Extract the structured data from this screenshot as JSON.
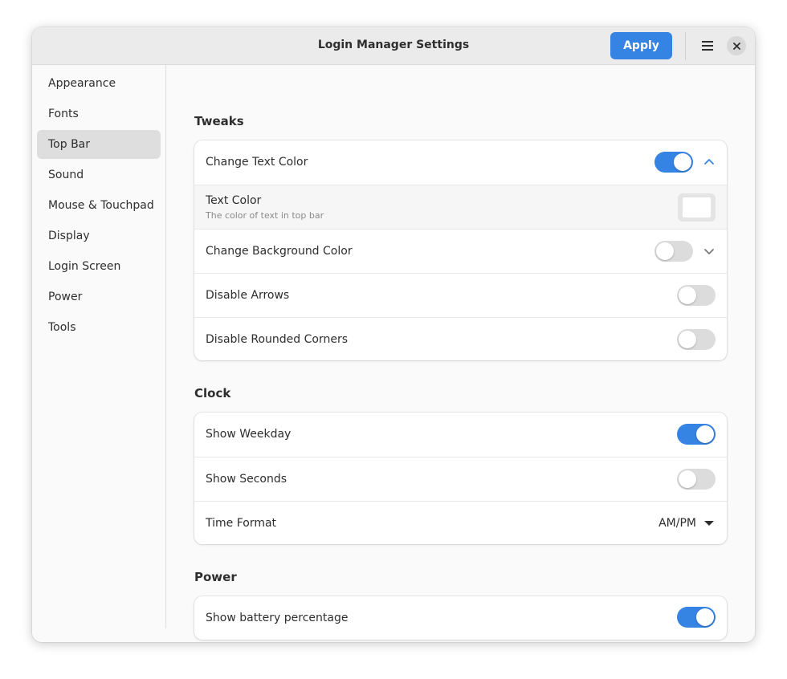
{
  "window": {
    "title": "Login Manager Settings",
    "apply_label": "Apply",
    "menu_icon": "hamburger-menu-icon",
    "close_icon": "close-icon"
  },
  "colors": {
    "accent": "#3584e4",
    "toggle_off": "#dcdcdc",
    "text": "#2e2e2e",
    "text_color_value": "#ffffff"
  },
  "sidebar": {
    "selected": "Top Bar",
    "items": [
      {
        "label": "Appearance"
      },
      {
        "label": "Fonts"
      },
      {
        "label": "Top Bar"
      },
      {
        "label": "Sound"
      },
      {
        "label": "Mouse & Touchpad"
      },
      {
        "label": "Display"
      },
      {
        "label": "Login Screen"
      },
      {
        "label": "Power"
      },
      {
        "label": "Tools"
      }
    ]
  },
  "sections": {
    "tweaks": {
      "title": "Tweaks",
      "change_text_color": {
        "label": "Change Text Color",
        "enabled": true,
        "expanded": true
      },
      "text_color": {
        "label": "Text Color",
        "subtitle": "The color of text in top bar"
      },
      "change_bg_color": {
        "label": "Change Background Color",
        "enabled": false,
        "expanded": false
      },
      "disable_arrows": {
        "label": "Disable Arrows",
        "enabled": false
      },
      "disable_rounded": {
        "label": "Disable Rounded Corners",
        "enabled": false
      }
    },
    "clock": {
      "title": "Clock",
      "show_weekday": {
        "label": "Show Weekday",
        "enabled": true
      },
      "show_seconds": {
        "label": "Show Seconds",
        "enabled": false
      },
      "time_format": {
        "label": "Time Format",
        "value": "AM/PM"
      }
    },
    "power": {
      "title": "Power",
      "battery": {
        "label": "Show battery percentage",
        "enabled": true
      }
    }
  }
}
